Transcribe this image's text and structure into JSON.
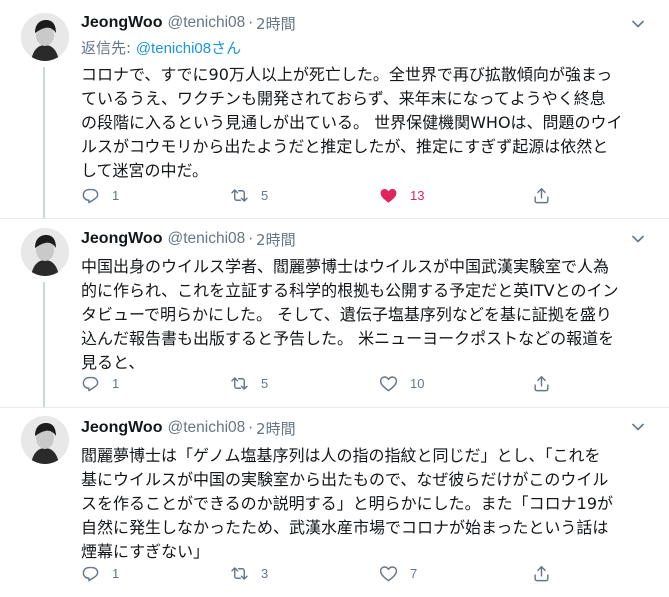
{
  "tweets": [
    {
      "name": "JeongWoo",
      "handle": "@tenichi08",
      "dot": "·",
      "time": "2時間",
      "replying_prefix": "返信先: ",
      "replying_link": "@tenichi08",
      "replying_suffix": "さん",
      "lines": [
        "コロナで、すでに90万人以上が死亡した。全世界で再び拡散傾向が強まっ",
        "ているうえ、ワクチンも開発されておらず、来年末になってようやく終息",
        "の段階に入るという見通しが出ている。 世界保健機関WHOは、問題のウイ",
        "ルスがコウモリから出たようだと推定したが、推定にすぎず起源は依然と",
        "して迷宮の中だ。"
      ],
      "replies": "1",
      "retweets": "5",
      "likes": "13",
      "liked": true
    },
    {
      "name": "JeongWoo",
      "handle": "@tenichi08",
      "dot": "·",
      "time": "2時間",
      "lines": [
        "中国出身のウイルス学者、閻麗夢博士はウイルスが中国武漢実験室で人為",
        "的に作られ、これを立証する科学的根拠も公開する予定だと英ITVとのイン",
        "タビューで明らかにした。 そして、遺伝子塩基序列などを基に証拠を盛り",
        "込んだ報告書も出版すると予告した。 米ニューヨークポストなどの報道を",
        "見ると、"
      ],
      "replies": "1",
      "retweets": "5",
      "likes": "10",
      "liked": false
    },
    {
      "name": "JeongWoo",
      "handle": "@tenichi08",
      "dot": "·",
      "time": "2時間",
      "lines": [
        "閻麗夢博士は「ゲノム塩基序列は人の指の指紋と同じだ」とし、「これを",
        "基にウイルスが中国の実験室から出たもので、なぜ彼らだけがこのウイル",
        "スを作ることができるのか説明する」と明らかにした。また「コロナ19が",
        "自然に発生しなかったため、武漢水産市場でコロナが始まったという話は",
        "煙幕にすぎない」"
      ],
      "replies": "1",
      "retweets": "3",
      "likes": "7",
      "liked": false
    }
  ],
  "icons": {
    "reply": "reply-icon",
    "retweet": "retweet-icon",
    "like": "heart-icon",
    "share": "share-icon",
    "caret": "chevron-down-icon"
  },
  "colors": {
    "text": "#14171a",
    "muted": "#657786",
    "link": "#1b95e0",
    "like": "#e0245e",
    "thread_line": "#ccd6dd"
  }
}
